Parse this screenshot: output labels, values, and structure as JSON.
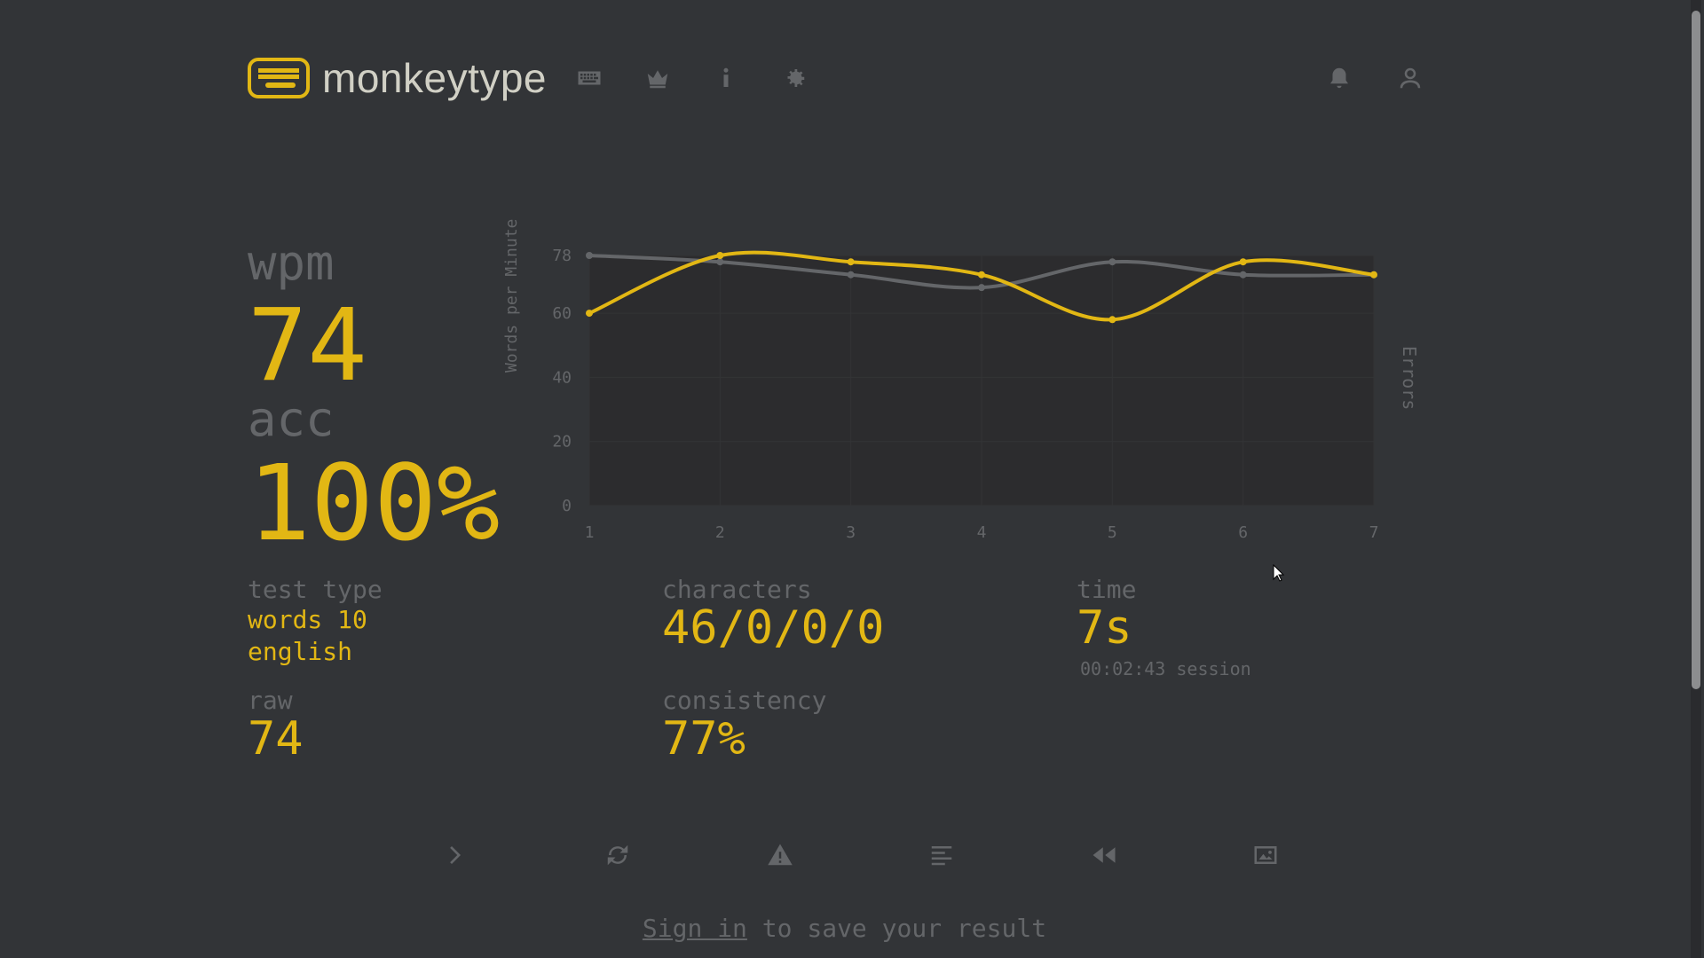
{
  "header": {
    "app_name": "monkeytype",
    "nav_icons": [
      "keyboard-icon",
      "crown-icon",
      "info-icon",
      "gear-icon"
    ],
    "right_icons": [
      "bell-icon",
      "user-icon"
    ]
  },
  "result": {
    "wpm_label": "wpm",
    "wpm_value": "74",
    "acc_label": "acc",
    "acc_value": "100%",
    "test_type_label": "test type",
    "test_type_mode": "words 10",
    "test_type_language": "english",
    "raw_label": "raw",
    "raw_value": "74",
    "characters_label": "characters",
    "characters_value": "46/0/0/0",
    "consistency_label": "consistency",
    "consistency_value": "77%",
    "time_label": "time",
    "time_value": "7s",
    "session_time": "00:02:43 session"
  },
  "buttons": [
    "next-test",
    "restart-test",
    "report-question",
    "words-history",
    "replay",
    "screenshot"
  ],
  "footer": {
    "signin_link": "Sign in",
    "signin_rest": " to save your result"
  },
  "colors": {
    "background": "#323437",
    "accent": "#e2b714",
    "sub": "#646669"
  },
  "chart_data": {
    "type": "line",
    "x": [
      1,
      2,
      3,
      4,
      5,
      6,
      7
    ],
    "xlabel": "",
    "ylabel": "Words per Minute",
    "ylabel_right": "Errors",
    "y_ticks": [
      0,
      20,
      40,
      60,
      78
    ],
    "ylim": [
      0,
      78
    ],
    "series": [
      {
        "values": [
          60,
          78,
          76,
          72,
          58,
          76,
          72
        ]
      },
      {
        "values": [
          78,
          76,
          72,
          68,
          76,
          72,
          72
        ]
      }
    ]
  }
}
